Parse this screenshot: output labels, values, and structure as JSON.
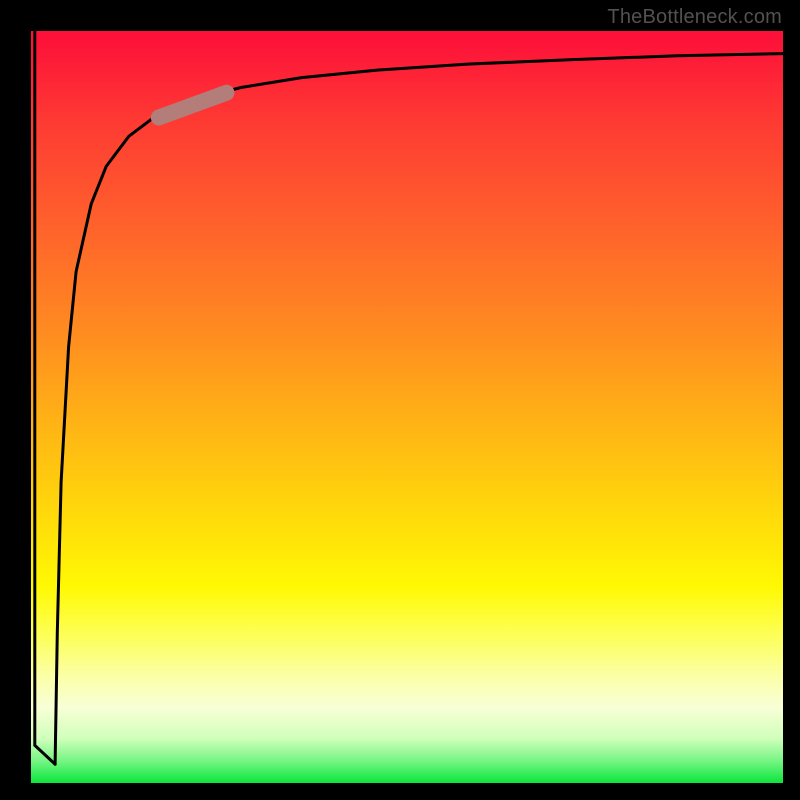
{
  "attribution": "TheBottleneck.com",
  "colors": {
    "background": "#000000",
    "curve": "#000000",
    "highlight": "#b37d7a",
    "gradient_top": "#fd1139",
    "gradient_mid": "#fff904",
    "gradient_bottom": "#0be63a"
  },
  "chart_data": {
    "type": "line",
    "title": "",
    "xlabel": "",
    "ylabel": "",
    "xlim": [
      0,
      100
    ],
    "ylim": [
      0,
      100
    ],
    "series": [
      {
        "name": "left-edge",
        "comment": "near-vertical stroke at far left, top to bottom",
        "x": [
          0.5,
          0.5,
          3.2
        ],
        "y": [
          100,
          5,
          2.5
        ]
      },
      {
        "name": "main-curve",
        "comment": "sharp rise from bottom-left then asymptote near top (~y=97)",
        "x": [
          3.2,
          3.5,
          4,
          5,
          6,
          8,
          10,
          13,
          17,
          22,
          28,
          36,
          46,
          58,
          72,
          86,
          100
        ],
        "y": [
          2.5,
          20,
          40,
          58,
          68,
          77,
          82,
          86,
          89,
          91,
          92.5,
          93.8,
          94.8,
          95.6,
          96.2,
          96.7,
          97
        ]
      }
    ],
    "highlight_segment": {
      "comment": "thick rounded pale-brown overlay on the curve near top-left bend",
      "x": [
        17,
        26
      ],
      "y": [
        88.5,
        91.8
      ]
    }
  }
}
